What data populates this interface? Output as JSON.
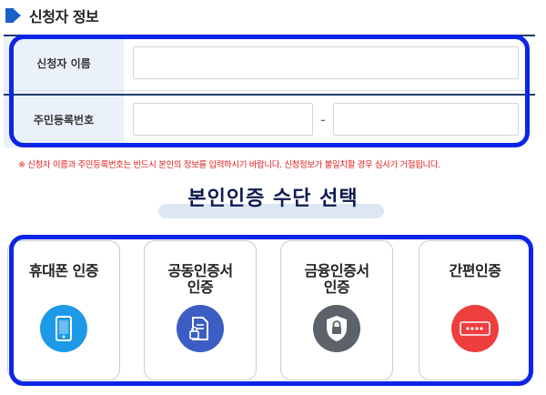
{
  "section": {
    "title": "신청자 정보"
  },
  "form": {
    "name_label": "신청자 이름",
    "name_value": "",
    "rrn_label": "주민등록번호",
    "rrn_front_value": "",
    "rrn_separator": "-",
    "rrn_back_value": ""
  },
  "notice": "※ 신청자 이름과 주민등록번호는 반드시 본인의 정보를 입력하시기 바랍니다. 신청정보가 불일치할 경우 심사가 거절됩니다.",
  "auth": {
    "title": "본인인증 수단 선택",
    "methods": [
      {
        "label_line1": "휴대폰 인증",
        "label_line2": "",
        "icon": "phone-icon",
        "color": "#1c9ae8"
      },
      {
        "label_line1": "공동인증서",
        "label_line2": "인증",
        "icon": "certificate-icon",
        "color": "#3b5dc4"
      },
      {
        "label_line1": "금융인증서",
        "label_line2": "인증",
        "icon": "shield-lock-icon",
        "color": "#5c6269"
      },
      {
        "label_line1": "간편인증",
        "label_line2": "",
        "icon": "password-icon",
        "color": "#ee3e3e"
      }
    ]
  },
  "colors": {
    "highlight": "#0c25e8",
    "accent": "#1b5fc9",
    "header_line": "#1f3a68",
    "notice": "#e02020"
  }
}
